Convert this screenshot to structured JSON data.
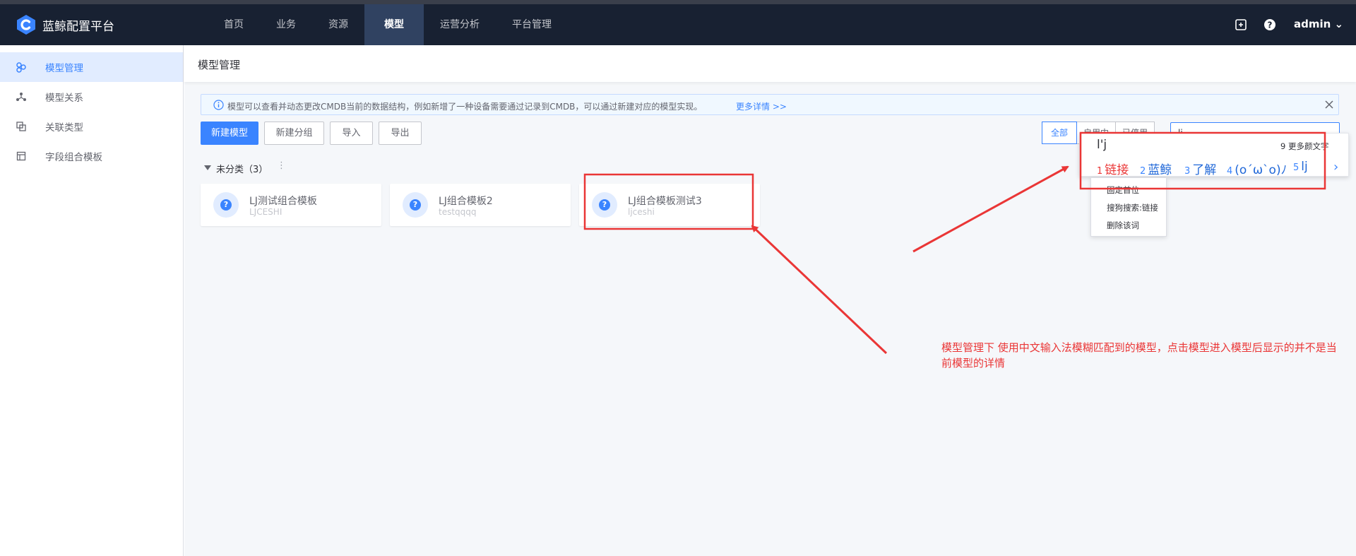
{
  "app": {
    "brand": "蓝鲸配置平台",
    "admin": "admin"
  },
  "nav": [
    {
      "label": "首页"
    },
    {
      "label": "业务"
    },
    {
      "label": "资源"
    },
    {
      "label": "模型"
    },
    {
      "label": "运营分析"
    },
    {
      "label": "平台管理"
    }
  ],
  "sidebar": {
    "items": [
      {
        "label": "模型管理",
        "icon": "model-icon"
      },
      {
        "label": "模型关系",
        "icon": "topology-icon"
      },
      {
        "label": "关联类型",
        "icon": "link-type-icon"
      },
      {
        "label": "字段组合模板",
        "icon": "template-icon"
      }
    ]
  },
  "page": {
    "title": "模型管理"
  },
  "alert": {
    "text": "模型可以查看并动态更改CMDB当前的数据结构，例如新增了一种设备需要通过记录到CMDB，可以通过新建对应的模型实现。",
    "link": "更多详情 >>"
  },
  "toolbar": {
    "new_model": "新建模型",
    "new_group": "新建分组",
    "import": "导入",
    "export": "导出"
  },
  "filters": [
    {
      "label": "全部"
    },
    {
      "label": "启用中"
    },
    {
      "label": "已停用"
    }
  ],
  "search": {
    "value": "lj"
  },
  "group": {
    "title": "未分类（3）",
    "more": "⋮"
  },
  "cards": [
    {
      "name": "LJ测试组合模板",
      "id": "LJCESHI"
    },
    {
      "name": "LJ组合模板2",
      "id": "testqqqq"
    },
    {
      "name": "LJ组合模板测试3",
      "id": "ljceshi"
    }
  ],
  "ime": {
    "pinyin": "l'j",
    "more": "9 更多颜文字",
    "candidates": [
      {
        "num": "1",
        "text": "链接"
      },
      {
        "num": "2",
        "text": "蓝鲸"
      },
      {
        "num": "3",
        "text": "了解"
      },
      {
        "num": "4",
        "text": "(o´ω`o)ﾉ"
      },
      {
        "num": "5",
        "text": "lj"
      }
    ],
    "next": "›",
    "menu": [
      "固定首位",
      "搜狗搜索:链接",
      "删除该词"
    ]
  },
  "annotation": {
    "text": "模型管理下 使用中文输入法模糊匹配到的模型，点击模型进入模型后显示的并不是当前模型的详情"
  },
  "colors": {
    "header": "#182132",
    "accent": "#3a84ff",
    "annotation": "#ea3636"
  }
}
